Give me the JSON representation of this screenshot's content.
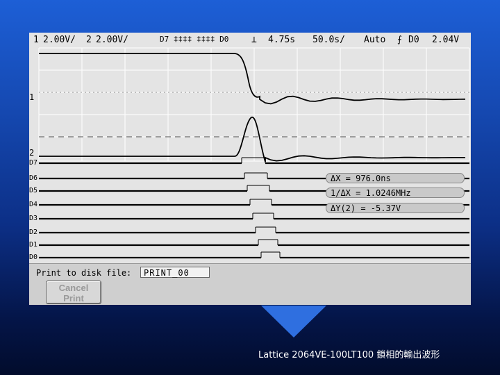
{
  "header": {
    "ch1_num": "1",
    "ch1_scale": "2.00V/",
    "ch2_num": "2",
    "ch2_scale": "2.00V/",
    "digital_range": "D7 ‡‡‡‡ ‡‡‡‡ D0",
    "time_offset": "4.75s",
    "timebase": "50.0s/",
    "trigger_mode": "Auto",
    "trigger_source": "D0",
    "trigger_level": "2.04V"
  },
  "channels": {
    "ch1_marker": "1",
    "ch2_marker": "2",
    "digital": [
      "D7",
      "D6",
      "D5",
      "D4",
      "D3",
      "D2",
      "D1",
      "D0"
    ]
  },
  "measurements": {
    "delta_x": "ΔX = 976.0ns",
    "inv_delta_x": "1/ΔX = 1.0246MHz",
    "delta_y": "ΔY(2) = -5.37V"
  },
  "print_bar": {
    "label": "Print to disk file:",
    "filename": "PRINT_00",
    "cancel_line1": "Cancel",
    "cancel_line2": "Print"
  },
  "caption": "Lattice 2064VE-100LT100 鎖相的輸出波形",
  "colors": {
    "screen_bg": "#e4e4e4",
    "grid": "#ffffff",
    "trace": "#000000",
    "pointer": "#2f6fe0"
  }
}
